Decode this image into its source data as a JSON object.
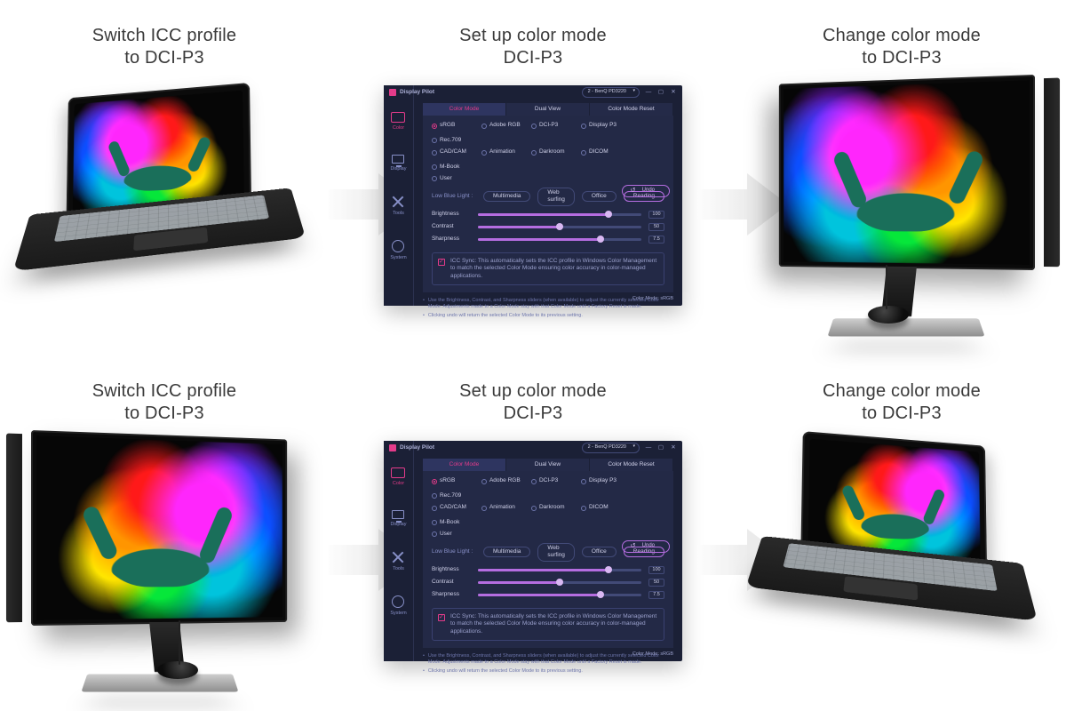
{
  "captions": {
    "left": {
      "line1": "Switch ICC profile",
      "line2": "to DCI-P3"
    },
    "center": {
      "line1": "Set up color mode",
      "line2": "DCI-P3"
    },
    "right": {
      "line1": "Change color mode",
      "line2": "to DCI-P3"
    }
  },
  "app": {
    "window_name": "Display Pilot",
    "display_selector": "2 - BenQ PD3220",
    "win_min": "—",
    "win_max": "▢",
    "win_close": "✕",
    "sidebar": [
      "Color",
      "Display",
      "Tools",
      "System"
    ],
    "tabs": {
      "t1": "Color Mode",
      "t2": "Dual View",
      "t3": "Color Mode Reset"
    },
    "modes": {
      "m1": "sRGB",
      "m2": "Adobe RGB",
      "m3": "DCI-P3",
      "m4": "Display P3",
      "m5": "Rec.709",
      "m6": "CAD/CAM",
      "m7": "Animation",
      "m8": "Darkroom",
      "m9": "DICOM",
      "m10": "M-Book",
      "m11": "User"
    },
    "lbl_label": "Low Blue Light :",
    "lbl": {
      "o1": "Multimedia",
      "o2": "Web surfing",
      "o3": "Office",
      "o4": "Reading"
    },
    "sliders": {
      "brightness": {
        "label": "Brightness",
        "value": "100",
        "pct": 80
      },
      "contrast": {
        "label": "Contrast",
        "value": "50",
        "pct": 50
      },
      "sharpness": {
        "label": "Sharpness",
        "value": "7.5",
        "pct": 75
      }
    },
    "undo": "Undo",
    "icc_text": "ICC Sync: This automatically sets the ICC profile in Windows Color Management to match the selected Color Mode ensuring color accuracy in color-managed applications.",
    "tips": {
      "t1": "Use the Brightness, Contrast, and Sharpness sliders (when available) to adjust the currently selected Color Mode. Adjustments made to a Color Mode stay with that Color Mode until a Factory Reset is made.",
      "t2": "Clicking undo will return the selected Color Mode to its previous setting."
    },
    "footer": "Color Mode: sRGB"
  }
}
